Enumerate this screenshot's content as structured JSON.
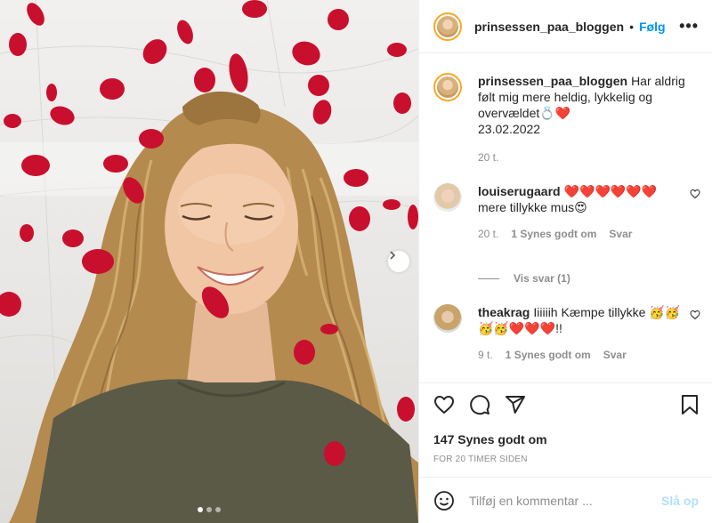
{
  "header": {
    "username": "prinsessen_paa_bloggen",
    "separator": "•",
    "follow_label": "Følg",
    "more_label": "•••"
  },
  "caption": {
    "username": "prinsessen_paa_bloggen",
    "text": "Har aldrig følt mig mere heldig, lykkelig og overvældet💍❤️",
    "date": "23.02.2022",
    "age": "20 t."
  },
  "comments": [
    {
      "username": "louiserugaard",
      "text": "❤️❤️❤️❤️❤️❤️ mere tillykke mus😍",
      "age": "20 t.",
      "likes": "1 Synes godt om",
      "reply_label": "Svar",
      "view_replies": "Vis svar (1)"
    },
    {
      "username": "theakrag",
      "text": "Iiiiiih Kæmpe tillykke 🥳🥳🥳🥳❤️❤️❤️!!",
      "age": "9 t.",
      "likes": "1 Synes godt om",
      "reply_label": "Svar"
    }
  ],
  "post": {
    "likes": "147 Synes godt om",
    "time": "FOR 20 TIMER SIDEN"
  },
  "add_comment": {
    "placeholder": "Tilføj en kommentar ...",
    "post_label": "Slå op"
  },
  "icons": {
    "like": "heart-icon",
    "comment": "comment-icon",
    "share": "share-icon",
    "save": "bookmark-icon",
    "emoji": "emoji-icon",
    "next": "chevron-right-icon"
  },
  "colors": {
    "follow": "#0095f6",
    "post_disabled": "#b2dffc",
    "muted": "#8e8e8e",
    "petal": "#c8102e"
  },
  "carousel": {
    "slides": 3,
    "active": 1
  }
}
